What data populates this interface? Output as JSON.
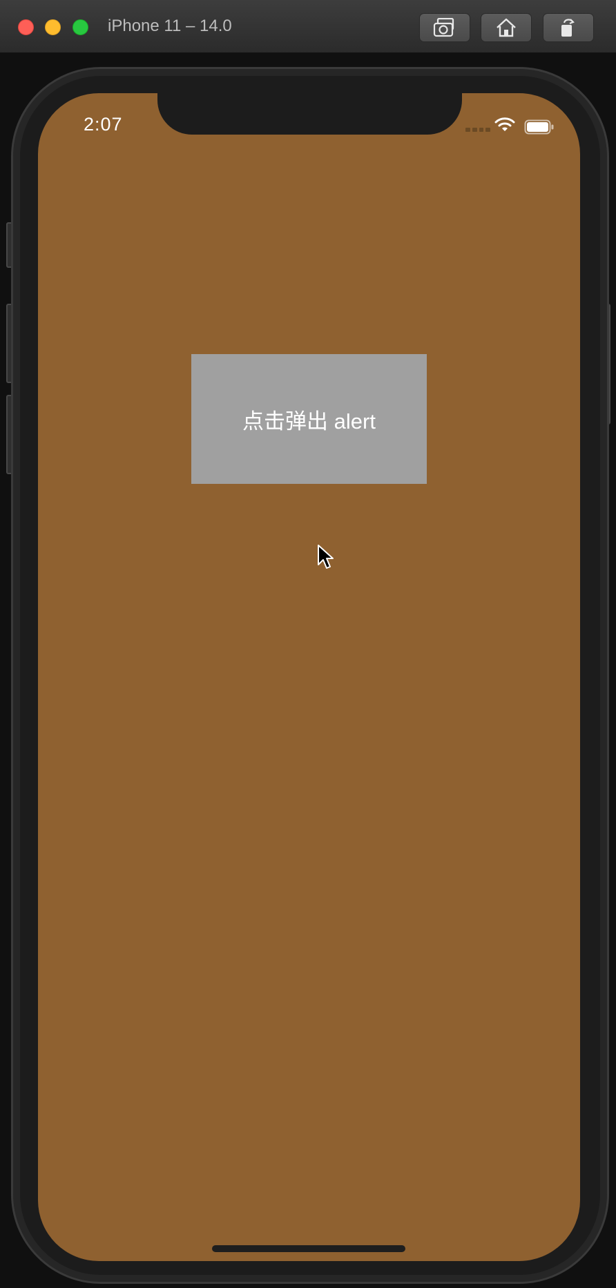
{
  "window": {
    "title": "iPhone 11 – 14.0",
    "toolbar_icons": [
      "camera-icon",
      "home-icon",
      "rotate-icon"
    ]
  },
  "status_bar": {
    "time": "2:07"
  },
  "main": {
    "button_label": "点击弹出 alert"
  },
  "colors": {
    "screen_background": "#8f6130",
    "button_background": "#a0a0a0",
    "button_text": "#ffffff"
  }
}
